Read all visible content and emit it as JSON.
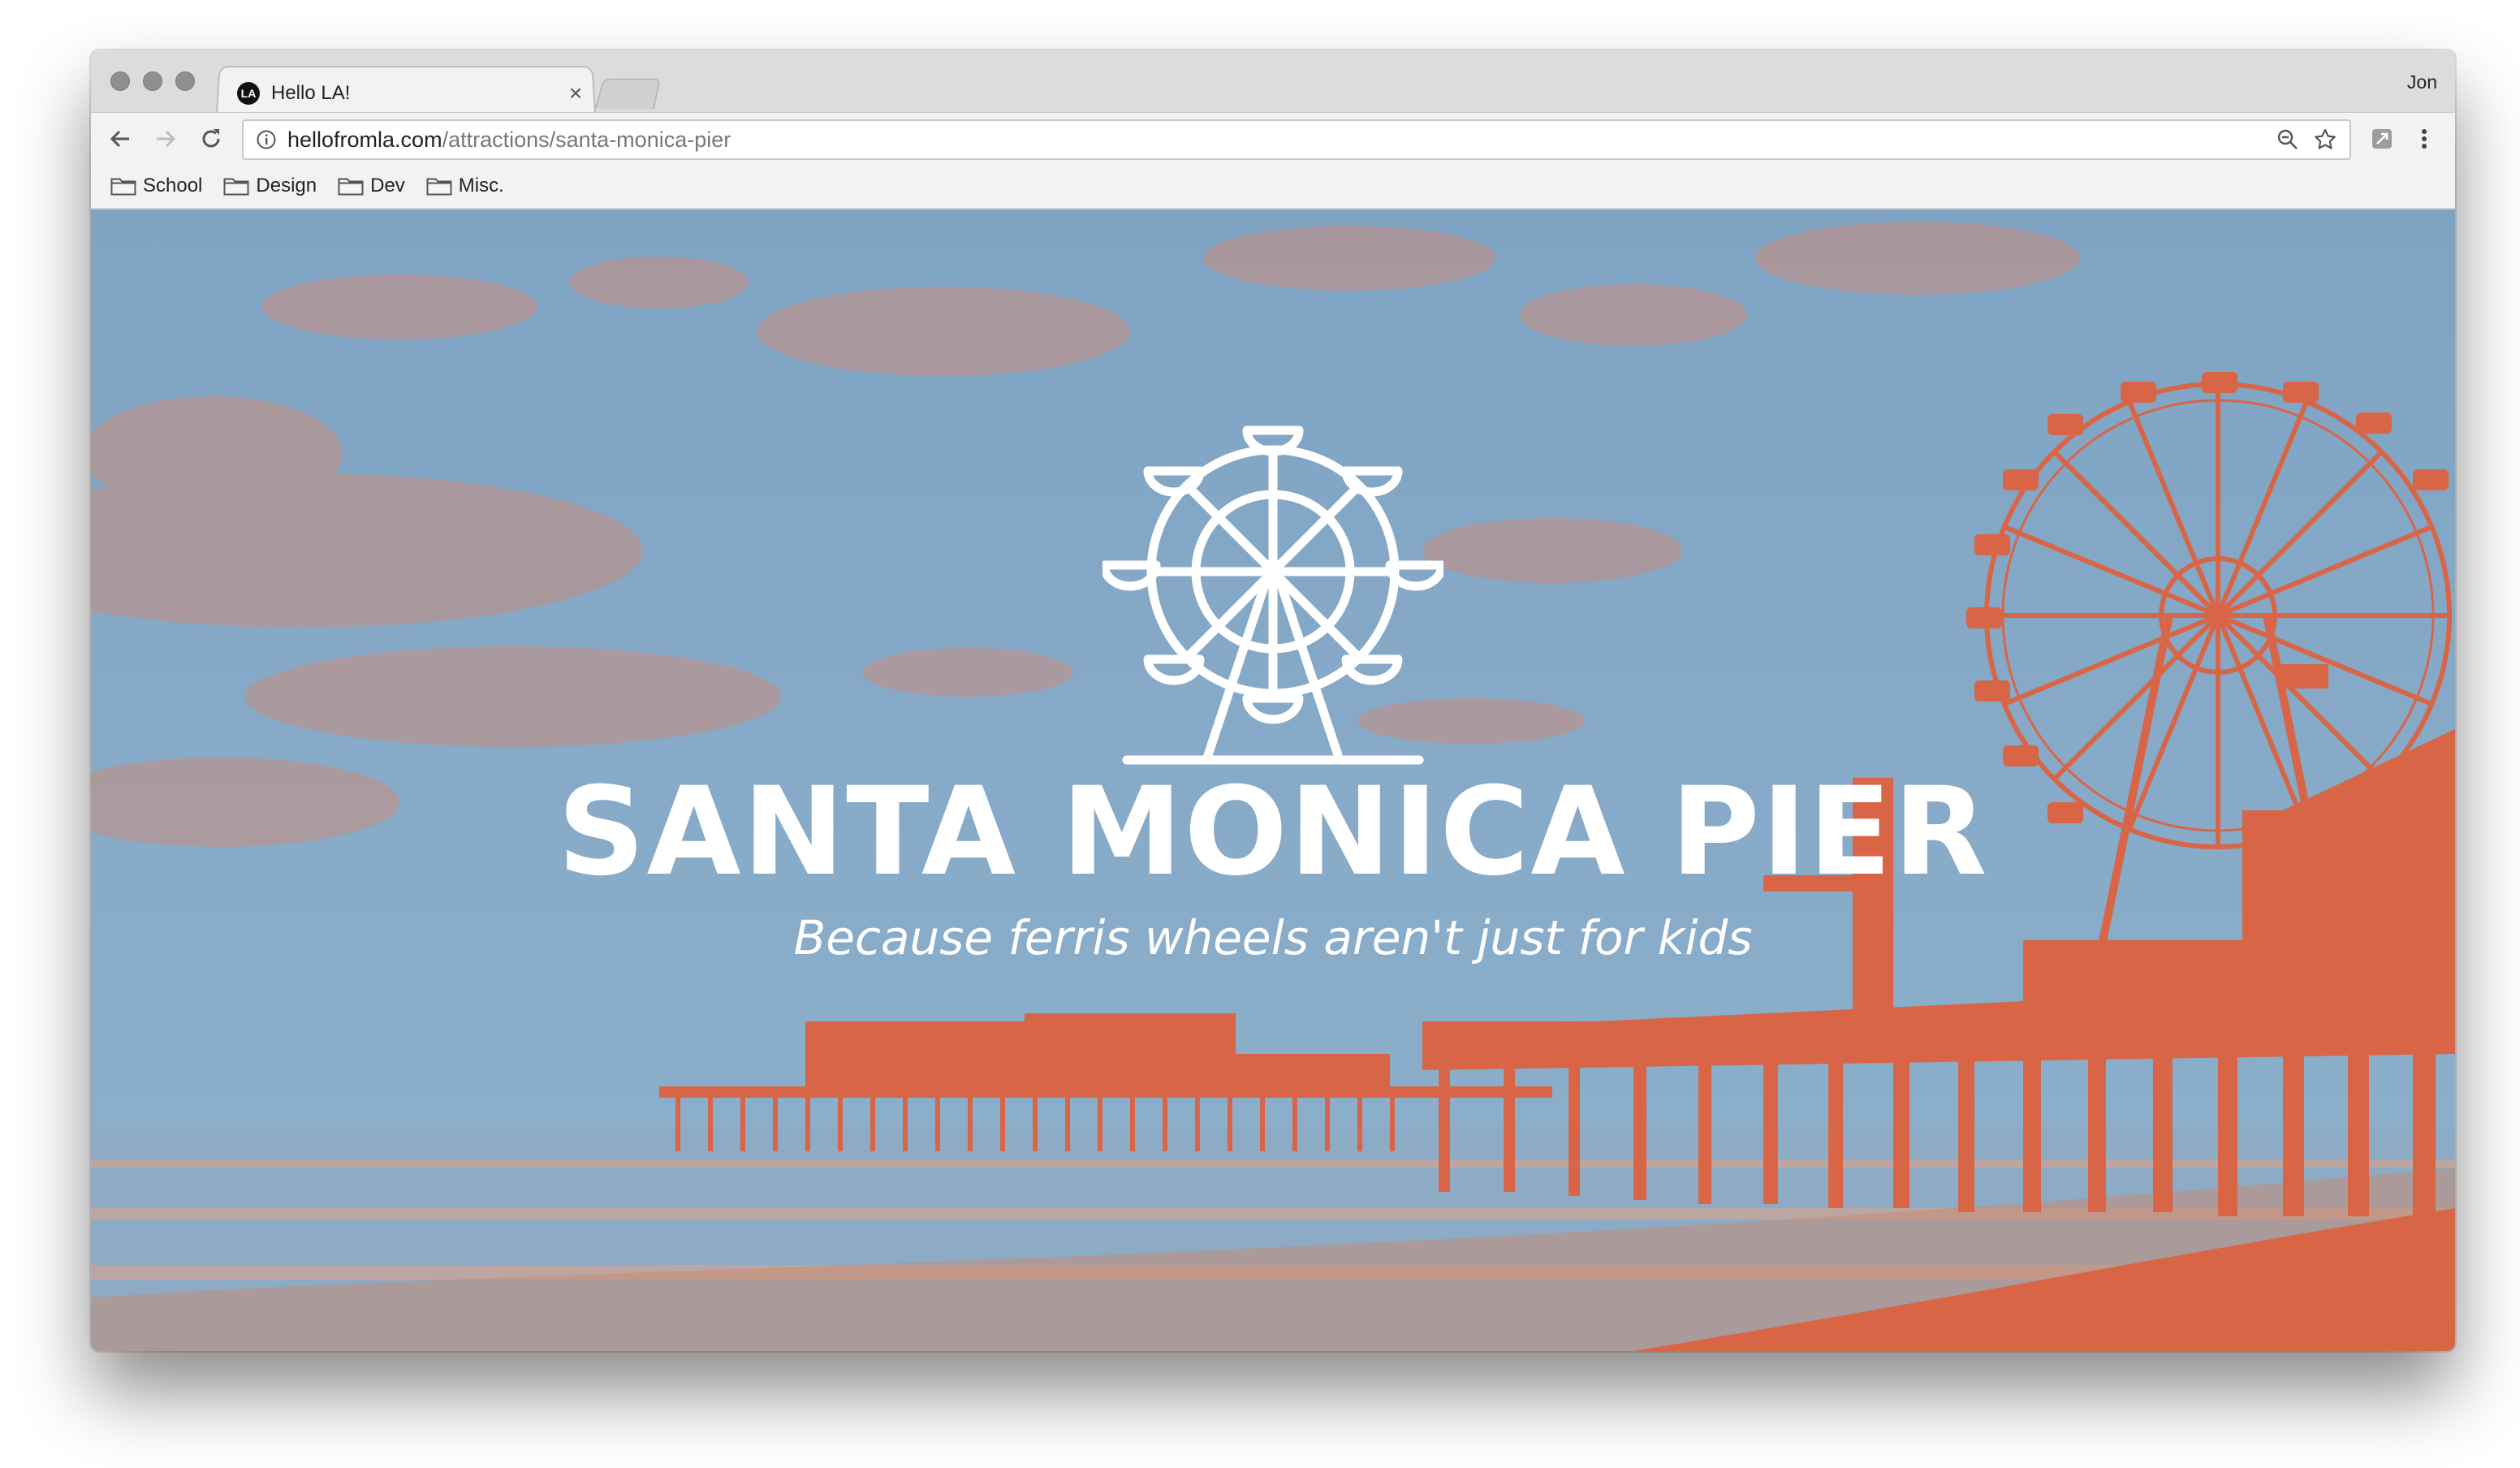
{
  "browser": {
    "tab": {
      "favicon_text": "LA",
      "title": "Hello LA!",
      "close_glyph": "×"
    },
    "profile_name": "Jon",
    "address_bar": {
      "domain": "hellofromla.com",
      "path": "/attractions/santa-monica-pier"
    },
    "bookmarks": [
      {
        "label": "School"
      },
      {
        "label": "Design"
      },
      {
        "label": "Dev"
      },
      {
        "label": "Misc."
      }
    ],
    "icons": {
      "back": "back-arrow-icon",
      "forward": "forward-arrow-icon",
      "reload": "reload-icon",
      "info": "info-icon",
      "zoom": "zoom-icon",
      "star": "star-icon",
      "extension": "extension-icon",
      "menu": "menu-icon",
      "folder": "folder-icon"
    }
  },
  "page": {
    "title": "SANTA MONICA PIER",
    "subtitle": "Because ferris wheels aren't just for kids",
    "logo_icon": "ferris-wheel-icon",
    "background": "duotone-santa-monica-pier-photo"
  },
  "colors": {
    "sky": "#86a9c6",
    "duotone_orange": "#d86546",
    "text": "#ffffff",
    "tab_strip": "#dcdcdc",
    "toolbar": "#f2f2f2"
  }
}
